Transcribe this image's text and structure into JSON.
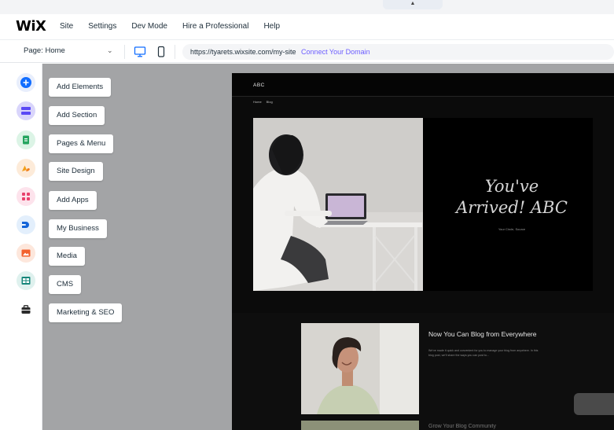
{
  "topbar": {
    "logo": "WiX",
    "menu": [
      "Site",
      "Settings",
      "Dev Mode",
      "Hire a Professional",
      "Help"
    ],
    "collapse_glyph": "▲"
  },
  "subbar": {
    "page_label": "Page: Home",
    "url": "https://tyarets.wixsite.com/my-site",
    "connect_domain": "Connect Your Domain"
  },
  "rail": {
    "icons": [
      {
        "name": "add-elements-icon",
        "bg": "#e8eefc",
        "fg": "#116dff"
      },
      {
        "name": "add-section-icon",
        "bg": "#e5e3fb",
        "fg": "#5a48f5"
      },
      {
        "name": "pages-menu-icon",
        "bg": "#dcf4e6",
        "fg": "#25a55f"
      },
      {
        "name": "site-design-icon",
        "bg": "#fdebd9",
        "fg": "#f28b1c"
      },
      {
        "name": "add-apps-icon",
        "bg": "#fde3ec",
        "fg": "#e8406c"
      },
      {
        "name": "my-business-icon",
        "bg": "#e3effc",
        "fg": "#1565d8"
      },
      {
        "name": "media-icon",
        "bg": "#fde7dc",
        "fg": "#f2622e"
      },
      {
        "name": "cms-icon",
        "bg": "#dff1ee",
        "fg": "#16867a"
      },
      {
        "name": "marketing-seo-icon",
        "bg": "#ffffff",
        "fg": "#2b2b2b"
      }
    ]
  },
  "panel": {
    "buttons": [
      "Add Elements",
      "Add Section",
      "Pages & Menu",
      "Site Design",
      "Add Apps",
      "My Business",
      "Media",
      "CMS",
      "Marketing & SEO"
    ]
  },
  "site": {
    "name": "ABC",
    "nav": [
      "Home",
      "Blog"
    ],
    "hero_title_line1": "You've",
    "hero_title_line2": "Arrived! ABC",
    "hero_subtitle": "Your Circle, Source",
    "blog_title": "Now You Can Blog from Everywhere",
    "blog_excerpt": "We've made it quick and convenient for you to manage your blog from anywhere. In this blog post, we'll share the ways you can post to...",
    "next_title": "Grow Your Blog Community"
  }
}
